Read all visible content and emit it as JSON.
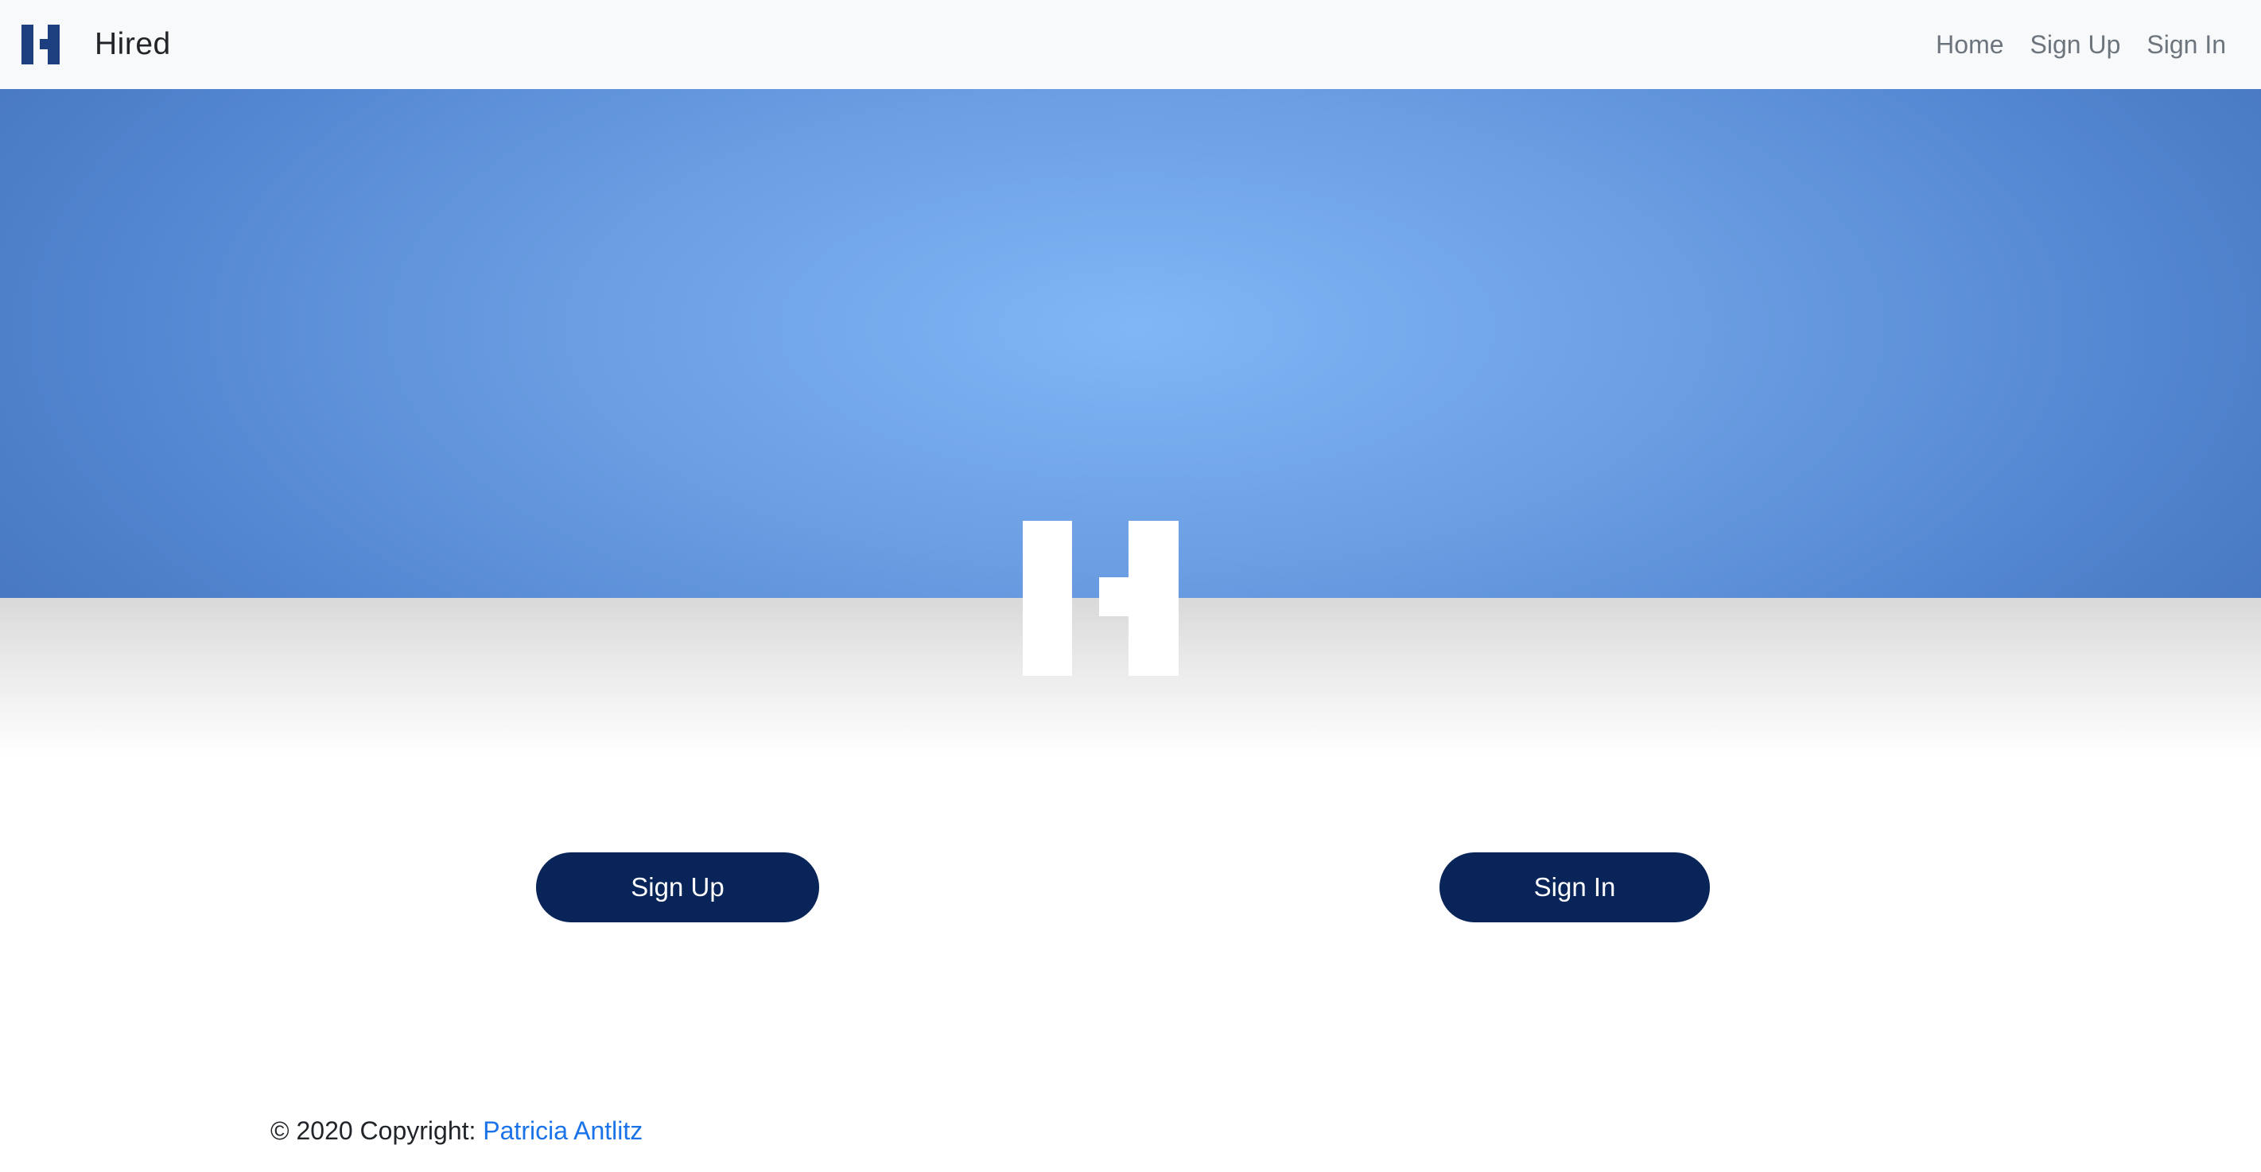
{
  "navbar": {
    "brand_name": "Hired",
    "brand_logo_icon": "hired-h-logo-icon",
    "links": [
      {
        "label": "Home"
      },
      {
        "label": "Sign Up"
      },
      {
        "label": "Sign In"
      }
    ]
  },
  "hero": {
    "logo_icon": "hired-h-logo-icon"
  },
  "actions": {
    "sign_up_label": "Sign Up",
    "sign_in_label": "Sign In"
  },
  "footer": {
    "copyright_text": "© 2020 Copyright:",
    "author_name": "Patricia Antlitz"
  },
  "colors": {
    "brand_navy": "#082459",
    "navbar_bg": "#f8f9fa",
    "hero_center": "#7fb7f6",
    "hero_edge": "#3f6db6",
    "link_blue": "#1a73e8",
    "nav_link_gray": "#6c757d"
  }
}
